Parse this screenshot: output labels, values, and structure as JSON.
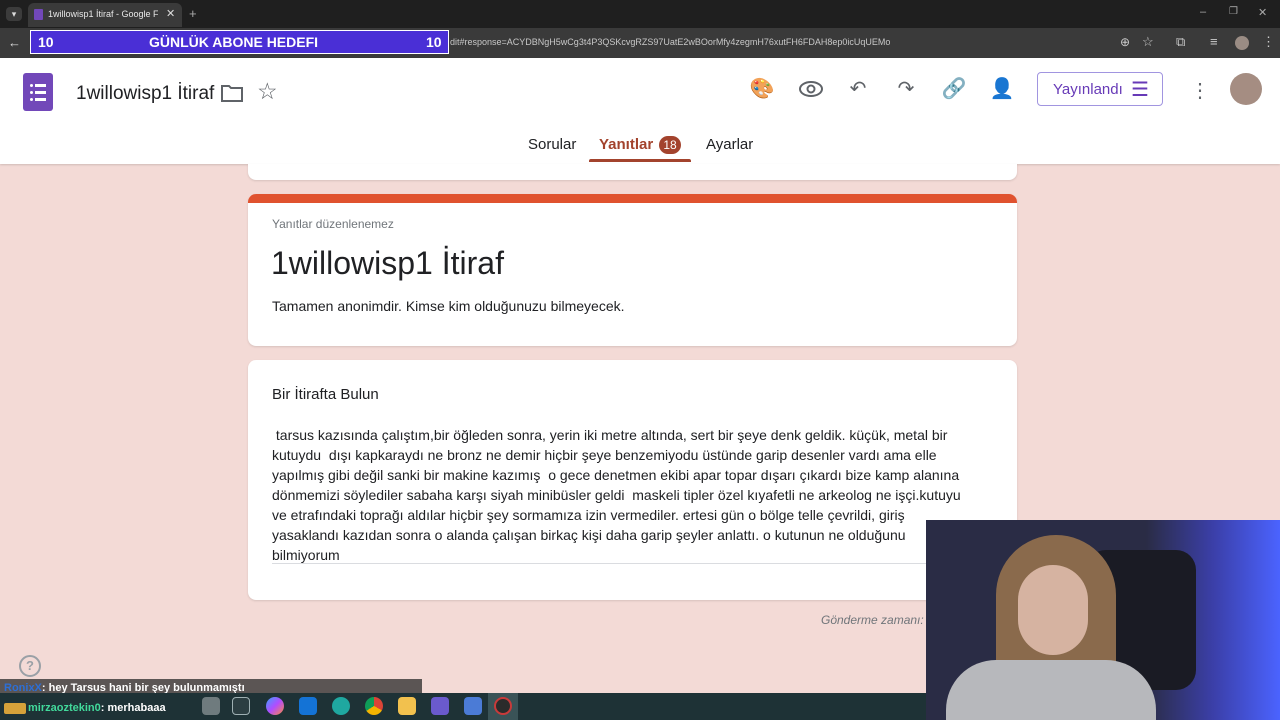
{
  "browser": {
    "tab_title": "1willowisp1 İtiraf - Google Forms",
    "url": "dit#response=ACYDBNgH5wCg3t4P3QSKcvgRZS97UatE2wBOorMfy4zegmH76xutFH6FDAH8ep0icUqUEMo"
  },
  "overlay_goal": {
    "left_count": "10",
    "title": "GÜNLÜK ABONE HEDEFI",
    "right_count": "10"
  },
  "form_header": {
    "title": "1willowisp1 İtiraf",
    "publish_label": "Yayınlandı",
    "tabs": {
      "questions": "Sorular",
      "responses": "Yanıtlar",
      "responses_badge": "18",
      "settings": "Ayarlar"
    }
  },
  "form_card": {
    "note": "Yanıtlar düzenlenemez",
    "title": "1willowisp1 İtiraf",
    "description": "Tamamen anonimdir. Kimse kim olduğunuzu bilmeyecek."
  },
  "question_card": {
    "question": "Bir İtirafta Bulun",
    "answer_lines": [
      " tarsus kazısında çalıştım,bir öğleden sonra, yerin iki metre altında, sert bir şeye denk geldik. küçük, metal bir",
      "kutuydu  dışı kapkaraydı ne bronz ne demir hiçbir şeye benzemiyodu üstünde garip desenler vardı ama elle",
      "yapılmış gibi değil sanki bir makine kazımış  o gece denetmen ekibi apar topar dışarı çıkardı bize kamp alanına",
      "dönmemizi söylediler sabaha karşı siyah minibüsler geldi  maskeli tipler özel kıyafetli ne arkeolog ne işçi.kutuyu",
      "ve etrafındaki toprağı aldılar hiçbir şey sormamıza izin vermediler. ertesi gün o bölge telle çevrildi, giriş",
      "yasaklandı kazıdan sonra o alanda çalışan birkaç kişi daha garip şeyler anlattı. o kutunun ne olduğunu",
      "bilmiyorum"
    ]
  },
  "submitted_label": "Gönderme zamanı: 5",
  "chat": [
    {
      "user": "RonixX",
      "message": ": hey Tarsus hani bir şey bulunmamıştı"
    },
    {
      "user": "mirzaoztekin0",
      "message": ": merhabaaa"
    }
  ],
  "colors": {
    "accent_purple": "#673ab7",
    "banner_orange": "#e0522f",
    "page_bg": "#f3dad6",
    "badge": "#a3432d"
  }
}
